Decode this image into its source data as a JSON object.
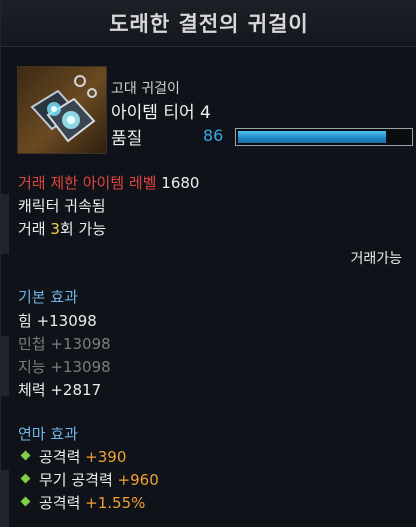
{
  "title": "도래한 결전의 귀걸이",
  "item": {
    "grade_type": "고대 귀걸이",
    "tier": "아이템 티어 4",
    "quality_label": "품질",
    "quality_value": "86",
    "quality_percent": 86
  },
  "restrictions": {
    "level_label": "거래 제한 아이템 레벨",
    "level_value": "1680",
    "bound": "캐릭터 귀속됨",
    "trade_prefix": "거래 ",
    "trade_count": "3",
    "trade_suffix": "회 가능",
    "tradeable": "거래가능"
  },
  "base_effects": {
    "header": "기본 효과",
    "lines": [
      {
        "text": "힘 +13098"
      },
      {
        "text": "민첩 +13098"
      },
      {
        "text": "지능 +13098"
      },
      {
        "text": "체력 +2817"
      }
    ]
  },
  "refine_effects": {
    "header": "연마 효과",
    "lines": [
      {
        "label": "공격력 ",
        "value": "+390"
      },
      {
        "label": "무기 공격력 ",
        "value": "+960"
      },
      {
        "label": "공격력 ",
        "value": "+1.55%"
      }
    ]
  },
  "colors": {
    "quality": "#3aa8e8",
    "restriction": "#e0443c",
    "trade_count": "#f6d24a",
    "section_header": "#6fb4e3",
    "bonus_value": "#f0a035",
    "bullet": "#7fd046"
  },
  "icons": {
    "item": "earring-icon",
    "bullet": "diamond-bullet-icon"
  }
}
